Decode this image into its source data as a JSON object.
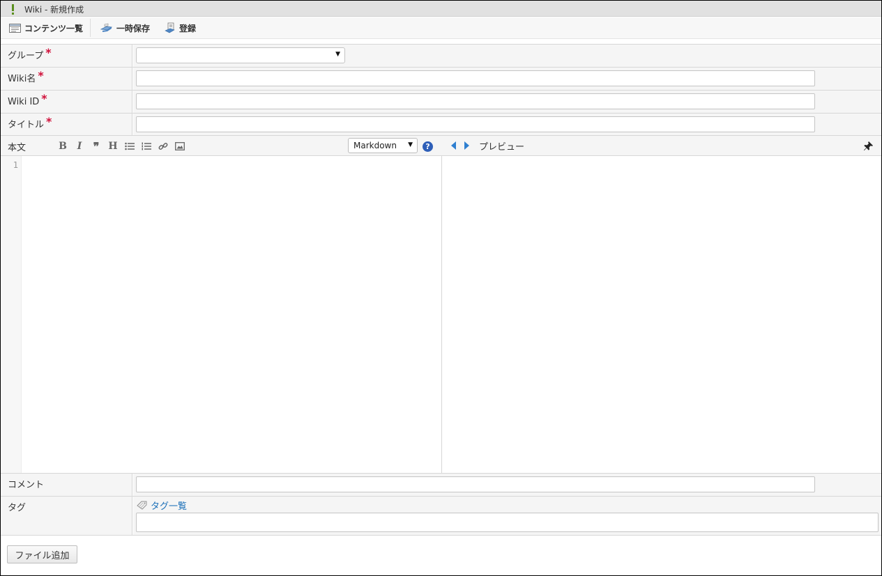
{
  "window": {
    "title": "Wiki - 新規作成"
  },
  "toolbar": {
    "contents_list": "コンテンツ一覧",
    "temp_save": "一時保存",
    "register": "登録"
  },
  "form": {
    "group": {
      "label": "グループ",
      "required_mark": "*",
      "selected": ""
    },
    "wiki_name": {
      "label": "Wiki名",
      "required_mark": "*",
      "value": ""
    },
    "wiki_id": {
      "label": "Wiki ID",
      "required_mark": "*",
      "value": ""
    },
    "title": {
      "label": "タイトル",
      "required_mark": "*",
      "value": ""
    },
    "body": {
      "label": "本文",
      "format_buttons": [
        "bold-icon",
        "italic-icon",
        "quote-icon",
        "heading-icon",
        "bullet-list-icon",
        "numbered-list-icon",
        "link-icon",
        "image-icon"
      ],
      "format_select": "Markdown",
      "help": "?",
      "preview_label": "プレビュー",
      "line_number": "1"
    },
    "comment": {
      "label": "コメント",
      "value": ""
    },
    "tags": {
      "label": "タグ",
      "link": "タグ一覧",
      "value": ""
    }
  },
  "file": {
    "add_button": "ファイル追加"
  },
  "colors": {
    "required": "#d0103a",
    "link": "#1a6fb8",
    "accent": "#2e5fb8"
  }
}
